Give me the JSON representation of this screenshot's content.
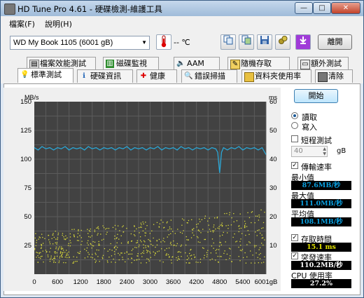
{
  "window": {
    "title": "HD Tune Pro 4.61 - 硬碟檢測-維護工具",
    "min": "—",
    "max": "□",
    "close": "✕"
  },
  "menu": {
    "file": "檔案(F)",
    "help": "說明(H)"
  },
  "toolbar": {
    "drive": "WD     My Book     1105 (6001 gB)",
    "temperature": "-- ℃",
    "exit": "離開",
    "icons": [
      "thermometer-icon",
      "copy-text-icon",
      "copy-screenshot-icon",
      "save-icon",
      "options-icon",
      "download-icon"
    ]
  },
  "tabs": {
    "row1": [
      {
        "label": "檔案效能測試",
        "icon": "file-benchmark-icon"
      },
      {
        "label": "磁碟監視",
        "icon": "disk-monitor-icon"
      },
      {
        "label": "AAM",
        "icon": "speaker-icon"
      },
      {
        "label": "隨機存取",
        "icon": "random-access-icon"
      },
      {
        "label": "額外測試",
        "icon": "extra-tests-icon"
      }
    ],
    "row2": [
      {
        "label": "標準測試",
        "icon": "benchmark-icon",
        "active": true
      },
      {
        "label": "硬碟資訊",
        "icon": "info-icon"
      },
      {
        "label": "健康",
        "icon": "health-icon"
      },
      {
        "label": "錯誤掃描",
        "icon": "error-scan-icon"
      },
      {
        "label": "資料夾使用率",
        "icon": "folder-usage-icon"
      },
      {
        "label": "清除",
        "icon": "erase-icon"
      }
    ]
  },
  "controls": {
    "start": "開始",
    "read": "讀取",
    "write": "寫入",
    "short_stroke": "短程測試",
    "short_stroke_value": "40",
    "short_stroke_unit": "gB",
    "transfer_rate": "傳輸速率",
    "minimum_label": "最小值",
    "minimum_value": "87.6MB/秒",
    "maximum_label": "最大值",
    "maximum_value": "111.0MB/秒",
    "average_label": "平均值",
    "average_value": "108.1MB/秒",
    "access_time_label": "存取時間",
    "access_time_value": "15.1 ms",
    "burst_rate_label": "突發速率",
    "burst_rate_value": "110.2MB/秒",
    "cpu_label": "CPU 使用率",
    "cpu_value": "27.2%"
  },
  "chart_data": {
    "type": "line",
    "y_left_label": "MB/s",
    "y_right_label": "ms",
    "x_unit": "gB",
    "xlim": [
      0,
      6001
    ],
    "ylim_left": [
      0,
      150
    ],
    "ylim_right": [
      0,
      60
    ],
    "x_ticks": [
      0,
      600,
      1200,
      1800,
      2400,
      3000,
      3600,
      4200,
      4800,
      5400,
      6001
    ],
    "y_left_ticks": [
      25,
      50,
      75,
      100,
      125,
      150
    ],
    "y_right_ticks": [
      10,
      20,
      30,
      40,
      50,
      60
    ],
    "grid": true,
    "colors": {
      "transfer": "#2aa7d6",
      "access": "#dede3a",
      "background": "#424242",
      "grid": "#5c5c5c"
    },
    "series": [
      {
        "name": "transfer-rate",
        "axis": "left",
        "x": [
          0,
          100,
          200,
          300,
          400,
          500,
          600,
          700,
          800,
          900,
          1000,
          1100,
          1200,
          1300,
          1400,
          1500,
          1600,
          1700,
          1800,
          1900,
          2000,
          2100,
          2200,
          2300,
          2400,
          2500,
          2600,
          2700,
          2800,
          2900,
          3000,
          3100,
          3200,
          3300,
          3400,
          3500,
          3600,
          3700,
          3800,
          3900,
          4000,
          4100,
          4200,
          4300,
          4400,
          4500,
          4600,
          4700,
          4750,
          4800,
          4850,
          4900,
          5000,
          5100,
          5200,
          5300,
          5400,
          5500,
          5600,
          5700,
          5800,
          5900,
          6001
        ],
        "values": [
          110,
          108,
          111,
          109,
          110,
          108,
          110,
          109,
          111,
          108,
          110,
          109,
          110,
          108,
          111,
          109,
          110,
          108,
          110,
          109,
          110,
          108,
          110,
          109,
          111,
          108,
          110,
          109,
          110,
          108,
          110,
          109,
          111,
          108,
          110,
          109,
          110,
          108,
          111,
          109,
          110,
          108,
          110,
          109,
          110,
          108,
          110,
          109,
          106,
          88,
          106,
          110,
          108,
          110,
          109,
          111,
          108,
          110,
          109,
          110,
          108,
          110,
          104
        ]
      },
      {
        "name": "access-time",
        "axis": "right",
        "values_range_ms": [
          4,
          23
        ],
        "description": "scattered points"
      }
    ]
  }
}
